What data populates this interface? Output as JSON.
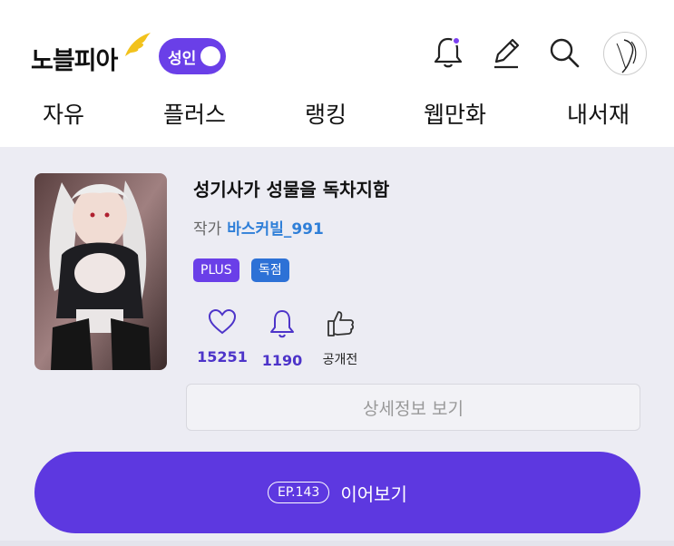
{
  "header": {
    "logo_text": "노블피아",
    "adult_label": "성인",
    "icons": [
      "bell-icon",
      "pen-icon",
      "search-icon",
      "avatar"
    ]
  },
  "nav": {
    "free": "자유",
    "plus": "플러스",
    "ranking": "랭킹",
    "webtoon": "웹만화",
    "library": "내서재"
  },
  "novel": {
    "title": "성기사가 성물을 독차지함",
    "author_label": "작가",
    "author_name": "바스커빌_991",
    "badges": {
      "plus": "PLUS",
      "exclusive": "독점"
    },
    "stats": {
      "likes": "15251",
      "subscribers": "1190",
      "recommend": "공개전"
    },
    "detail_button": "상세정보 보기",
    "continue": {
      "episode": "EP.143",
      "label": "이어보기"
    }
  },
  "colors": {
    "accent": "#5d38e0",
    "author_link": "#2f7fd8",
    "background": "#ececf3"
  }
}
